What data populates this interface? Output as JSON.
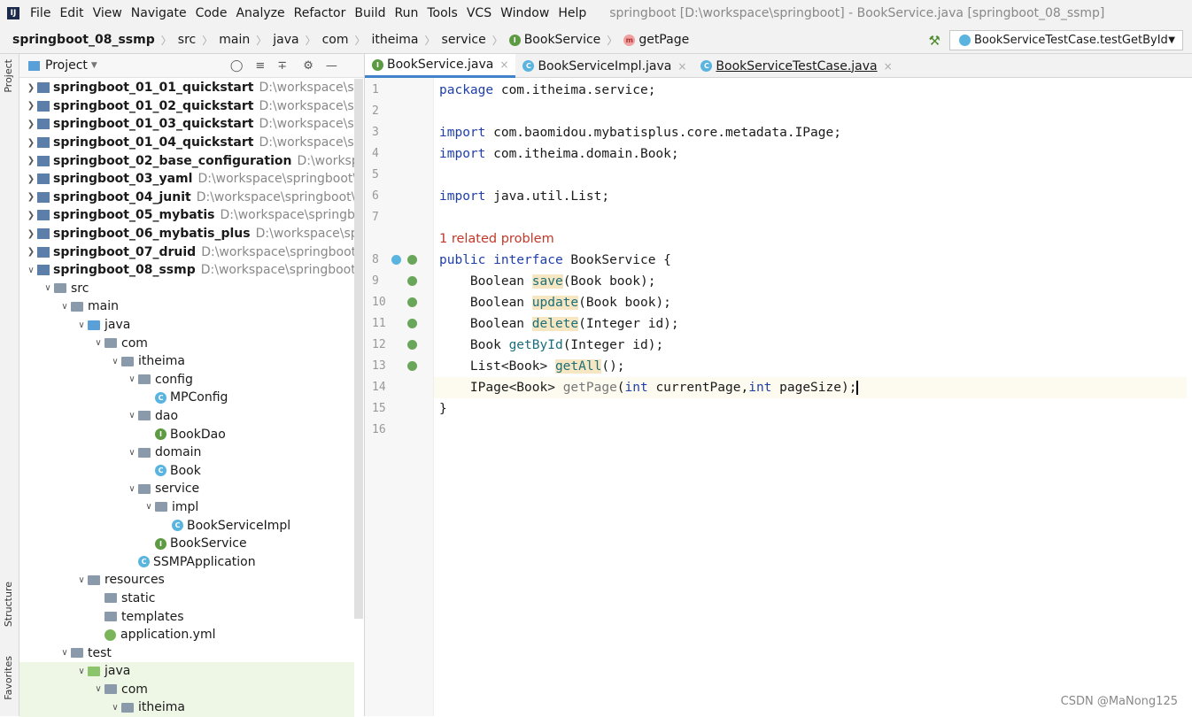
{
  "menu": {
    "items": [
      "File",
      "Edit",
      "View",
      "Navigate",
      "Code",
      "Analyze",
      "Refactor",
      "Build",
      "Run",
      "Tools",
      "VCS",
      "Window",
      "Help"
    ],
    "window_title": "springboot [D:\\workspace\\springboot] - BookService.java [springboot_08_ssmp]"
  },
  "breadcrumb": [
    "springboot_08_ssmp",
    "src",
    "main",
    "java",
    "com",
    "itheima",
    "service",
    "BookService",
    "getPage"
  ],
  "run_config": "BookServiceTestCase.testGetById",
  "side": {
    "project": "Project",
    "structure": "Structure",
    "favorites": "Favorites"
  },
  "project_panel": {
    "title": "Project"
  },
  "tree": [
    {
      "d": 0,
      "a": ">",
      "t": "mod",
      "n": "springboot_01_01_quickstart",
      "p": "D:\\workspace\\springboot"
    },
    {
      "d": 0,
      "a": ">",
      "t": "mod",
      "n": "springboot_01_02_quickstart",
      "p": "D:\\workspace\\springboot"
    },
    {
      "d": 0,
      "a": ">",
      "t": "mod",
      "n": "springboot_01_03_quickstart",
      "p": "D:\\workspace\\springboot"
    },
    {
      "d": 0,
      "a": ">",
      "t": "mod",
      "n": "springboot_01_04_quickstart",
      "p": "D:\\workspace\\springboot"
    },
    {
      "d": 0,
      "a": ">",
      "t": "mod",
      "n": "springboot_02_base_configuration",
      "p": "D:\\workspace\\springboot"
    },
    {
      "d": 0,
      "a": ">",
      "t": "mod",
      "n": "springboot_03_yaml",
      "p": "D:\\workspace\\springboot\\springboot"
    },
    {
      "d": 0,
      "a": ">",
      "t": "mod",
      "n": "springboot_04_junit",
      "p": "D:\\workspace\\springboot\\springboot"
    },
    {
      "d": 0,
      "a": ">",
      "t": "mod",
      "n": "springboot_05_mybatis",
      "p": "D:\\workspace\\springboot\\springboot"
    },
    {
      "d": 0,
      "a": ">",
      "t": "mod",
      "n": "springboot_06_mybatis_plus",
      "p": "D:\\workspace\\springboot"
    },
    {
      "d": 0,
      "a": ">",
      "t": "mod",
      "n": "springboot_07_druid",
      "p": "D:\\workspace\\springboot\\springboot"
    },
    {
      "d": 0,
      "a": "v",
      "t": "mod",
      "n": "springboot_08_ssmp",
      "p": "D:\\workspace\\springboot\\springboot"
    },
    {
      "d": 1,
      "a": "v",
      "t": "fold",
      "n": "src"
    },
    {
      "d": 2,
      "a": "v",
      "t": "fold",
      "n": "main"
    },
    {
      "d": 3,
      "a": "v",
      "t": "blue",
      "n": "java"
    },
    {
      "d": 4,
      "a": "v",
      "t": "fold",
      "n": "com"
    },
    {
      "d": 5,
      "a": "v",
      "t": "fold",
      "n": "itheima"
    },
    {
      "d": 6,
      "a": "v",
      "t": "fold",
      "n": "config"
    },
    {
      "d": 7,
      "a": "",
      "t": "c",
      "n": "MPConfig"
    },
    {
      "d": 6,
      "a": "v",
      "t": "fold",
      "n": "dao"
    },
    {
      "d": 7,
      "a": "",
      "t": "i",
      "n": "BookDao"
    },
    {
      "d": 6,
      "a": "v",
      "t": "fold",
      "n": "domain"
    },
    {
      "d": 7,
      "a": "",
      "t": "c",
      "n": "Book"
    },
    {
      "d": 6,
      "a": "v",
      "t": "fold",
      "n": "service"
    },
    {
      "d": 7,
      "a": "v",
      "t": "fold",
      "n": "impl"
    },
    {
      "d": 8,
      "a": "",
      "t": "c",
      "n": "BookServiceImpl"
    },
    {
      "d": 7,
      "a": "",
      "t": "i",
      "n": "BookService"
    },
    {
      "d": 6,
      "a": "",
      "t": "c",
      "n": "SSMPApplication"
    },
    {
      "d": 3,
      "a": "v",
      "t": "fold",
      "n": "resources"
    },
    {
      "d": 4,
      "a": "",
      "t": "fold",
      "n": "static"
    },
    {
      "d": 4,
      "a": "",
      "t": "fold",
      "n": "templates"
    },
    {
      "d": 4,
      "a": "",
      "t": "yml",
      "n": "application.yml"
    },
    {
      "d": 2,
      "a": "v",
      "t": "fold",
      "n": "test"
    },
    {
      "d": 3,
      "a": "v",
      "t": "green",
      "n": "java",
      "x": 1
    },
    {
      "d": 4,
      "a": "v",
      "t": "fold",
      "n": "com",
      "x": 1
    },
    {
      "d": 5,
      "a": "v",
      "t": "fold",
      "n": "itheima",
      "x": 1
    }
  ],
  "tabs": [
    {
      "label": "BookService.java",
      "icon": "i",
      "active": true
    },
    {
      "label": "BookServiceImpl.java",
      "icon": "c"
    },
    {
      "label": "BookServiceTestCase.java",
      "icon": "c",
      "u": true
    }
  ],
  "code": {
    "problem": "1 related problem",
    "lines": [
      [
        [
          "package ",
          "kw"
        ],
        [
          "com.itheima.service;",
          ""
        ]
      ],
      [],
      [
        [
          "import ",
          "kw"
        ],
        [
          "com.baomidou.mybatisplus.core.metadata.IPage;",
          ""
        ]
      ],
      [
        [
          "import ",
          "kw"
        ],
        [
          "com.itheima.domain.Book;",
          ""
        ]
      ],
      [],
      [
        [
          "import ",
          "kw"
        ],
        [
          "java.util.List;",
          ""
        ]
      ],
      [],
      [
        [
          "public ",
          "kw"
        ],
        [
          "interface ",
          "kw"
        ],
        [
          "BookService {",
          ""
        ]
      ],
      [
        [
          "    Boolean ",
          ""
        ],
        [
          "save",
          "fn hl"
        ],
        [
          "(Book book);",
          ""
        ]
      ],
      [
        [
          "    Boolean ",
          ""
        ],
        [
          "update",
          "fn hl"
        ],
        [
          "(Book book);",
          ""
        ]
      ],
      [
        [
          "    Boolean ",
          ""
        ],
        [
          "delete",
          "fn hl"
        ],
        [
          "(Integer id);",
          ""
        ]
      ],
      [
        [
          "    Book ",
          ""
        ],
        [
          "getById",
          "fn"
        ],
        [
          "(Integer id);",
          ""
        ]
      ],
      [
        [
          "    List<Book> ",
          ""
        ],
        [
          "getAll",
          "fn hl"
        ],
        [
          "();",
          ""
        ]
      ],
      [
        [
          "    IPage<Book> ",
          ""
        ],
        [
          "getPage",
          "gr"
        ],
        [
          "(",
          ""
        ],
        [
          "int ",
          "kw"
        ],
        [
          "currentPage,",
          ""
        ],
        [
          "int ",
          "kw"
        ],
        [
          "pageSize);",
          ""
        ]
      ],
      [
        [
          "}",
          ""
        ]
      ],
      []
    ]
  },
  "watermark": "CSDN @MaNong125"
}
